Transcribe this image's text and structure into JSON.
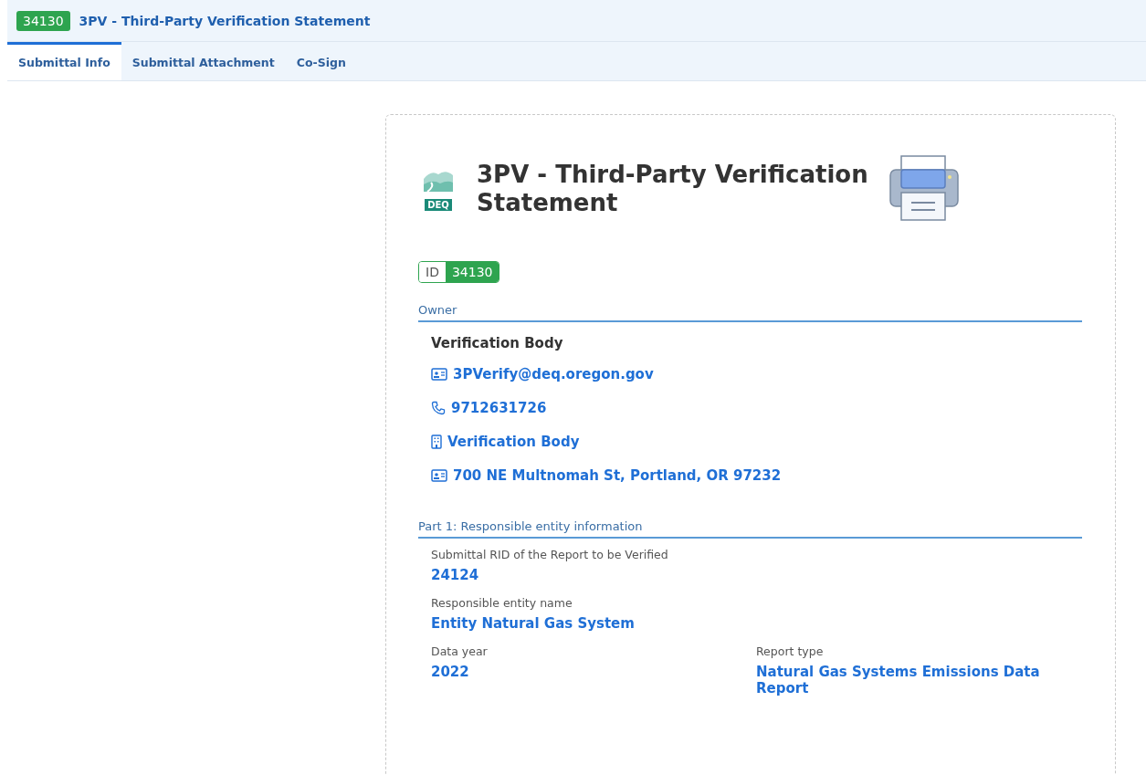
{
  "header": {
    "badge": "34130",
    "title": "3PV - Third-Party Verification Statement"
  },
  "tabs": [
    {
      "label": "Submittal Info",
      "selected": true
    },
    {
      "label": "Submittal Attachment",
      "selected": false
    },
    {
      "label": "Co-Sign",
      "selected": false
    }
  ],
  "document": {
    "logo_text": "DEQ",
    "title": "3PV - Third-Party Verification Statement",
    "id_label": "ID",
    "id_value": "34130",
    "owner": {
      "heading": "Owner",
      "name": "Verification Body",
      "contacts": [
        {
          "kind": "email",
          "text": "3PVerify@deq.oregon.gov"
        },
        {
          "kind": "phone",
          "text": "9712631726"
        },
        {
          "kind": "building",
          "text": "Verification Body"
        },
        {
          "kind": "address",
          "text": "700 NE Multnomah St, Portland, OR 97232"
        }
      ]
    },
    "part1": {
      "heading": "Part 1: Responsible entity information",
      "rows": [
        [
          {
            "label": "Submittal RID of the Report to be Verified",
            "value": "24124"
          }
        ],
        [
          {
            "label": "Responsible entity name",
            "value": "Entity Natural Gas System"
          }
        ],
        [
          {
            "label": "Data year",
            "value": "2022"
          },
          {
            "label": "Report type",
            "value": "Natural Gas Systems Emissions Data Report"
          }
        ]
      ]
    }
  }
}
